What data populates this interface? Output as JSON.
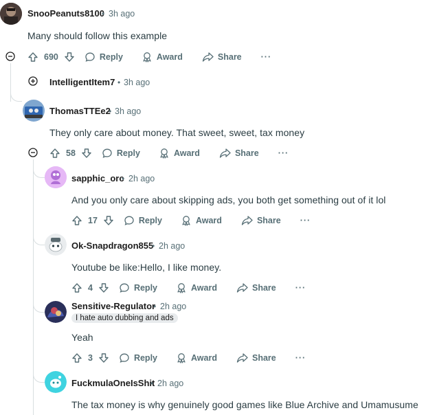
{
  "comments": [
    {
      "username": "SnooPeanuts8100",
      "dot": "•",
      "time": "3h ago",
      "text": "Many should follow this example",
      "score": "690",
      "reply": "Reply",
      "award": "Award",
      "share": "Share",
      "more": "···"
    },
    {
      "username": "IntelligentItem7",
      "dot": "•",
      "time": "3h ago"
    },
    {
      "username": "ThomasTTEe2",
      "dot": "•",
      "time": "3h ago",
      "text": "They only care about money. That sweet, sweet, tax money",
      "score": "58",
      "reply": "Reply",
      "award": "Award",
      "share": "Share",
      "more": "···"
    },
    {
      "username": "sapphic_orc",
      "dot": "•",
      "time": "2h ago",
      "text": "And you only care about skipping ads, you both get something out of it lol",
      "score": "17",
      "reply": "Reply",
      "award": "Award",
      "share": "Share",
      "more": "···"
    },
    {
      "username": "Ok-Snapdragon855",
      "dot": "•",
      "time": "2h ago",
      "text": "Youtube be like:Hello, I like money.",
      "score": "4",
      "reply": "Reply",
      "award": "Award",
      "share": "Share",
      "more": "···"
    },
    {
      "username": "Sensitive-Regulator",
      "dot": "•",
      "time": "2h ago",
      "flair": "I hate auto dubbing and ads",
      "text": "Yeah",
      "score": "3",
      "reply": "Reply",
      "award": "Award",
      "share": "Share",
      "more": "···"
    },
    {
      "username": "FuckmulaOneIsShit",
      "dot": "•",
      "time": "2h ago",
      "text": "The tax money is why genuinely good games like Blue Archive and Umamusume"
    }
  ],
  "colors": {
    "text": "#2a3c42",
    "meta": "#576f76",
    "thread": "#d8dee0"
  }
}
